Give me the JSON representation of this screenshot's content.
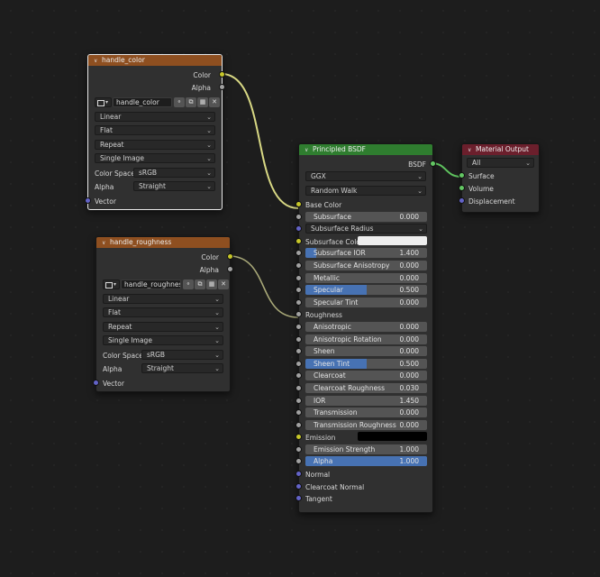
{
  "colors": {
    "texture_header": "#8e4f20",
    "shader_header": "#2f7d2f",
    "output_header": "#6b1f2c",
    "socket_color": "#c7c729",
    "socket_float": "#a1a1a1",
    "socket_shader": "#63c763",
    "socket_vector": "#6363c7",
    "slider_fill": "#4772b3",
    "subsurface_color_swatch": "#eeeeee",
    "emission_swatch": "#000000"
  },
  "node_handle_color": {
    "title": "handle_color",
    "outputs": [
      "Color",
      "Alpha"
    ],
    "image_name": "handle_color",
    "interpolation": "Linear",
    "projection": "Flat",
    "extension": "Repeat",
    "source": "Single Image",
    "color_space_label": "Color Space",
    "color_space": "sRGB",
    "alpha_label": "Alpha",
    "alpha_mode": "Straight",
    "input_vector": "Vector"
  },
  "node_handle_roughness": {
    "title": "handle_roughness",
    "outputs": [
      "Color",
      "Alpha"
    ],
    "image_name": "handle_roughness",
    "interpolation": "Linear",
    "projection": "Flat",
    "extension": "Repeat",
    "source": "Single Image",
    "color_space_label": "Color Space",
    "color_space": "sRGB",
    "alpha_label": "Alpha",
    "alpha_mode": "Straight",
    "input_vector": "Vector"
  },
  "node_bsdf": {
    "title": "Principled BSDF",
    "output": "BSDF",
    "distribution": "GGX",
    "subsurface_method": "Random Walk",
    "base_color": "Base Color",
    "subsurface": {
      "name": "Subsurface",
      "value": "0.000",
      "fill": 0.0
    },
    "subsurface_radius": "Subsurface Radius",
    "subsurface_color": "Subsurface Color",
    "subsurface_ior": {
      "name": "Subsurface IOR",
      "value": "1.400",
      "fill": 0.09
    },
    "subsurface_anisotropy": {
      "name": "Subsurface Anisotropy",
      "value": "0.000",
      "fill": 0.0
    },
    "metallic": {
      "name": "Metallic",
      "value": "0.000",
      "fill": 0.0
    },
    "specular": {
      "name": "Specular",
      "value": "0.500",
      "fill": 0.5
    },
    "specular_tint": {
      "name": "Specular Tint",
      "value": "0.000",
      "fill": 0.0
    },
    "roughness": "Roughness",
    "anisotropic": {
      "name": "Anisotropic",
      "value": "0.000",
      "fill": 0.0
    },
    "anisotropic_rotation": {
      "name": "Anisotropic Rotation",
      "value": "0.000",
      "fill": 0.0
    },
    "sheen": {
      "name": "Sheen",
      "value": "0.000",
      "fill": 0.0
    },
    "sheen_tint": {
      "name": "Sheen Tint",
      "value": "0.500",
      "fill": 0.5
    },
    "clearcoat": {
      "name": "Clearcoat",
      "value": "0.000",
      "fill": 0.0
    },
    "clearcoat_roughness": {
      "name": "Clearcoat Roughness",
      "value": "0.030",
      "fill": 0.0
    },
    "ior": {
      "name": "IOR",
      "value": "1.450",
      "fill": 0.0
    },
    "transmission": {
      "name": "Transmission",
      "value": "0.000",
      "fill": 0.0
    },
    "transmission_roughness": {
      "name": "Transmission Roughness",
      "value": "0.000",
      "fill": 0.0
    },
    "emission": "Emission",
    "emission_strength": {
      "name": "Emission Strength",
      "value": "1.000",
      "fill": 0.0
    },
    "alpha": {
      "name": "Alpha",
      "value": "1.000",
      "fill": 1.0
    },
    "normal": "Normal",
    "clearcoat_normal": "Clearcoat Normal",
    "tangent": "Tangent"
  },
  "node_output": {
    "title": "Material Output",
    "target": "All",
    "inputs": [
      "Surface",
      "Volume",
      "Displacement"
    ]
  }
}
